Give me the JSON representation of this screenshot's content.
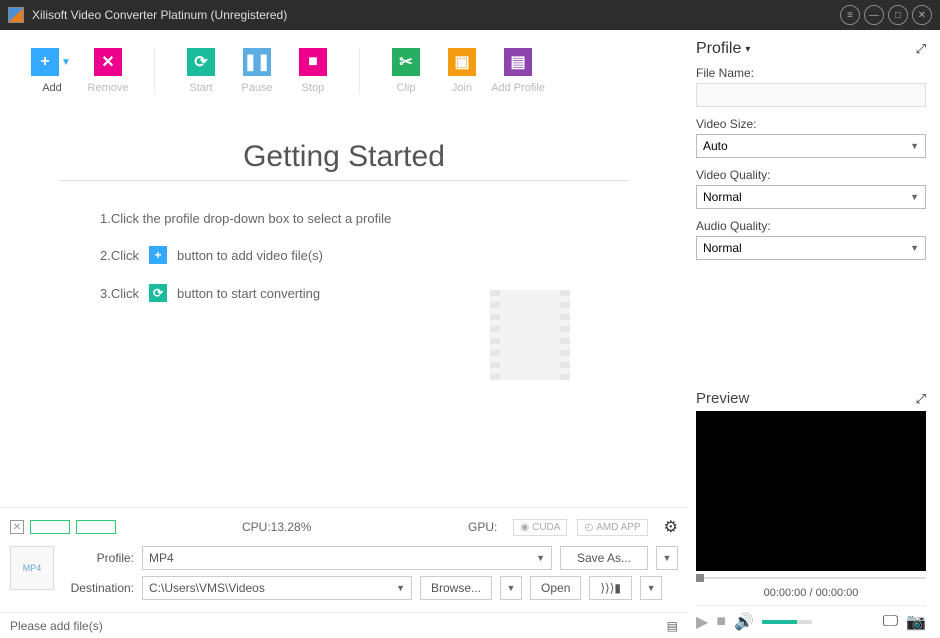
{
  "window": {
    "title": "Xilisoft Video Converter Platinum (Unregistered)"
  },
  "toolbar": {
    "add": "Add",
    "remove": "Remove",
    "start": "Start",
    "pause": "Pause",
    "stop": "Stop",
    "clip": "Clip",
    "join": "Join",
    "add_profile": "Add Profile"
  },
  "getting_started": {
    "title": "Getting Started",
    "step1": "1.Click the profile drop-down box to select a profile",
    "step2_a": "2.Click",
    "step2_b": "button to add video file(s)",
    "step3_a": "3.Click",
    "step3_b": "button to start converting"
  },
  "meters": {
    "cpu_label": "CPU:13.28%",
    "gpu_label": "GPU:",
    "cuda": "CUDA",
    "amd": "AMD APP"
  },
  "form": {
    "profile_label": "Profile:",
    "profile_value": "MP4",
    "save_as": "Save As...",
    "dest_label": "Destination:",
    "dest_value": "C:\\Users\\VMS\\Videos",
    "browse": "Browse...",
    "open": "Open",
    "merge": "⟩⟩⟩▮"
  },
  "status": "Please add file(s)",
  "profile_panel": {
    "title": "Profile",
    "file_name": "File Name:",
    "video_size": "Video Size:",
    "video_size_val": "Auto",
    "video_quality": "Video Quality:",
    "video_quality_val": "Normal",
    "audio_quality": "Audio Quality:",
    "audio_quality_val": "Normal"
  },
  "preview": {
    "title": "Preview",
    "time": "00:00:00 / 00:00:00"
  }
}
